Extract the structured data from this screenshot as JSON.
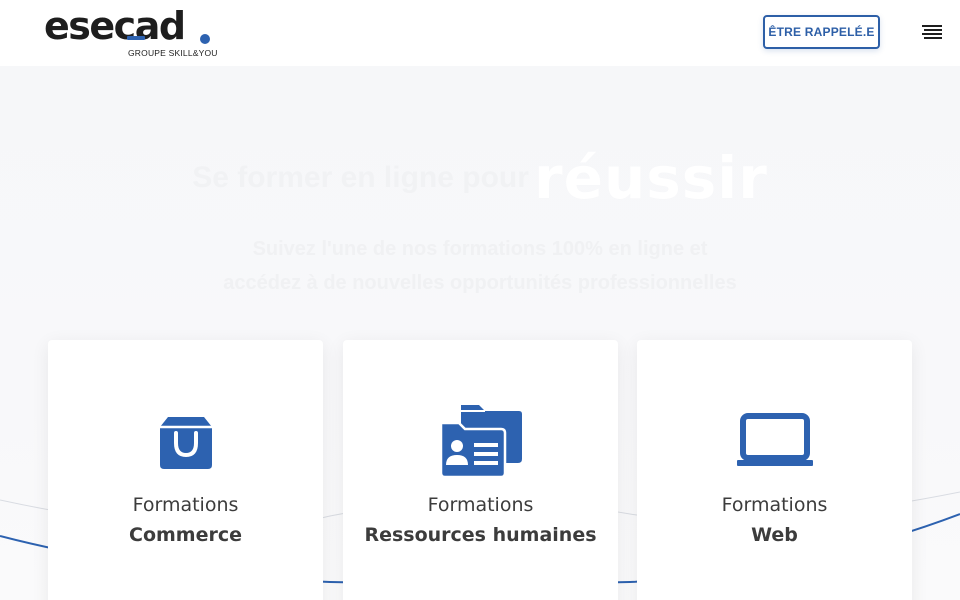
{
  "brand": {
    "name": "esecad",
    "tagline": "GROUPE SKILL&YOU",
    "accent_color": "#2d62b0"
  },
  "header": {
    "cta_label": "ÊTRE RAPPELÉ.E",
    "menu_icon": "hamburger-menu-icon"
  },
  "hero": {
    "title_lead": "Se former en ligne pour",
    "title_key": "réussir",
    "text_line1": "Suivez l'une de nos formations 100% en ligne et",
    "text_line2": "accédez à de nouvelles opportunités professionnelles"
  },
  "cards": [
    {
      "icon": "shopping-bag-icon",
      "line1": "Formations",
      "line2": "Commerce"
    },
    {
      "icon": "contact-folders-icon",
      "line1": "Formations",
      "line2": "Ressources humaines"
    },
    {
      "icon": "laptop-icon",
      "line1": "Formations",
      "line2": "Web"
    }
  ]
}
